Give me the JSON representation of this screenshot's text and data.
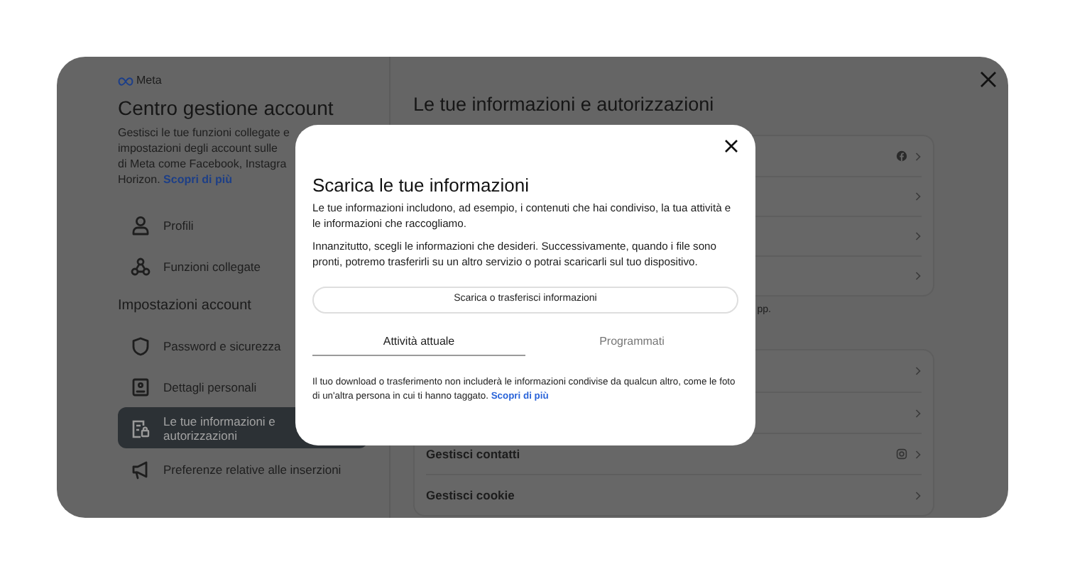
{
  "brand": "Meta",
  "sidebar": {
    "title": "Centro gestione account",
    "description_lines": [
      "Gestisci le tue funzioni collegate e",
      "impostazioni degli account sulle",
      "di Meta come Facebook, Instagra",
      "Horizon."
    ],
    "description_link": "Scopri di più",
    "items": [
      {
        "label": "Profili",
        "selected": false
      },
      {
        "label": "Funzioni collegate",
        "selected": false
      }
    ],
    "section_title": "Impostazioni account",
    "section_items": [
      {
        "label": "Password e sicurezza",
        "selected": false
      },
      {
        "label": "Dettagli personali",
        "selected": false
      },
      {
        "label": "Le tue informazioni e autorizzazioni",
        "selected": true
      },
      {
        "label": "Preferenze relative alle inserzioni",
        "selected": false
      }
    ]
  },
  "main": {
    "title": "Le tue informazioni e autorizzazioni",
    "card_1_rows": [
      {
        "kind": "badged"
      },
      {
        "kind": "link"
      },
      {
        "kind": "link"
      },
      {
        "kind": "link"
      }
    ],
    "note": "pp.",
    "card_2_rows": [
      {
        "kind": "link"
      },
      {
        "kind": "link"
      },
      {
        "kind": "badged",
        "label": "Gestisci contatti"
      },
      {
        "kind": "link",
        "label": "Gestisci cookie"
      }
    ]
  },
  "dialog": {
    "title": "Scarica le tue informazioni",
    "paragraphs": [
      "Le tue informazioni includono, ad esempio, i contenuti che hai condiviso, la tua attività e le informazioni che raccogliamo.",
      "Innanzitutto, scegli le informazioni che desideri. Successivamente, quando i file sono pronti, potremo trasferirli su un altro servizio o potrai scaricarli sul tuo dispositivo."
    ],
    "button": "Scarica o trasferisci informazioni",
    "tabs": [
      {
        "label": "Attività attuale",
        "selected": true
      },
      {
        "label": "Programmati",
        "selected": false
      }
    ],
    "footer": "Il tuo download o trasferimento non includerà le informazioni condivise da qualcun altro, come le foto di un'altra persona in cui ti hanno taggato.",
    "footer_link": "Scopri di più"
  }
}
